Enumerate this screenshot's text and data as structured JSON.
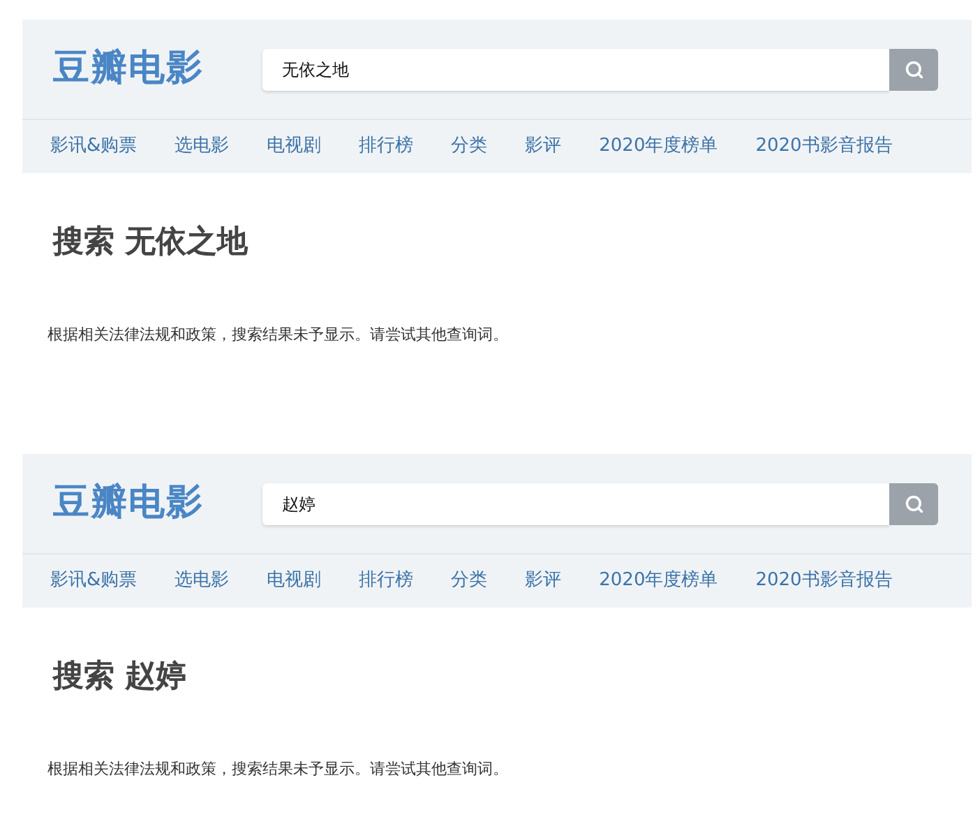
{
  "panels": [
    {
      "logo": "豆瓣电影",
      "search": {
        "value": "无依之地"
      },
      "nav": [
        "影讯&购票",
        "选电影",
        "电视剧",
        "排行榜",
        "分类",
        "影评",
        "2020年度榜单",
        "2020书影音报告"
      ],
      "heading": "搜索 无依之地",
      "message": "根据相关法律法规和政策，搜索结果未予显示。请尝试其他查询词。"
    },
    {
      "logo": "豆瓣电影",
      "search": {
        "value": "赵婷"
      },
      "nav": [
        "影讯&购票",
        "选电影",
        "电视剧",
        "排行榜",
        "分类",
        "影评",
        "2020年度榜单",
        "2020书影音报告"
      ],
      "heading": "搜索 赵婷",
      "message": "根据相关法律法规和政策，搜索结果未予显示。请尝试其他查询词。"
    }
  ]
}
